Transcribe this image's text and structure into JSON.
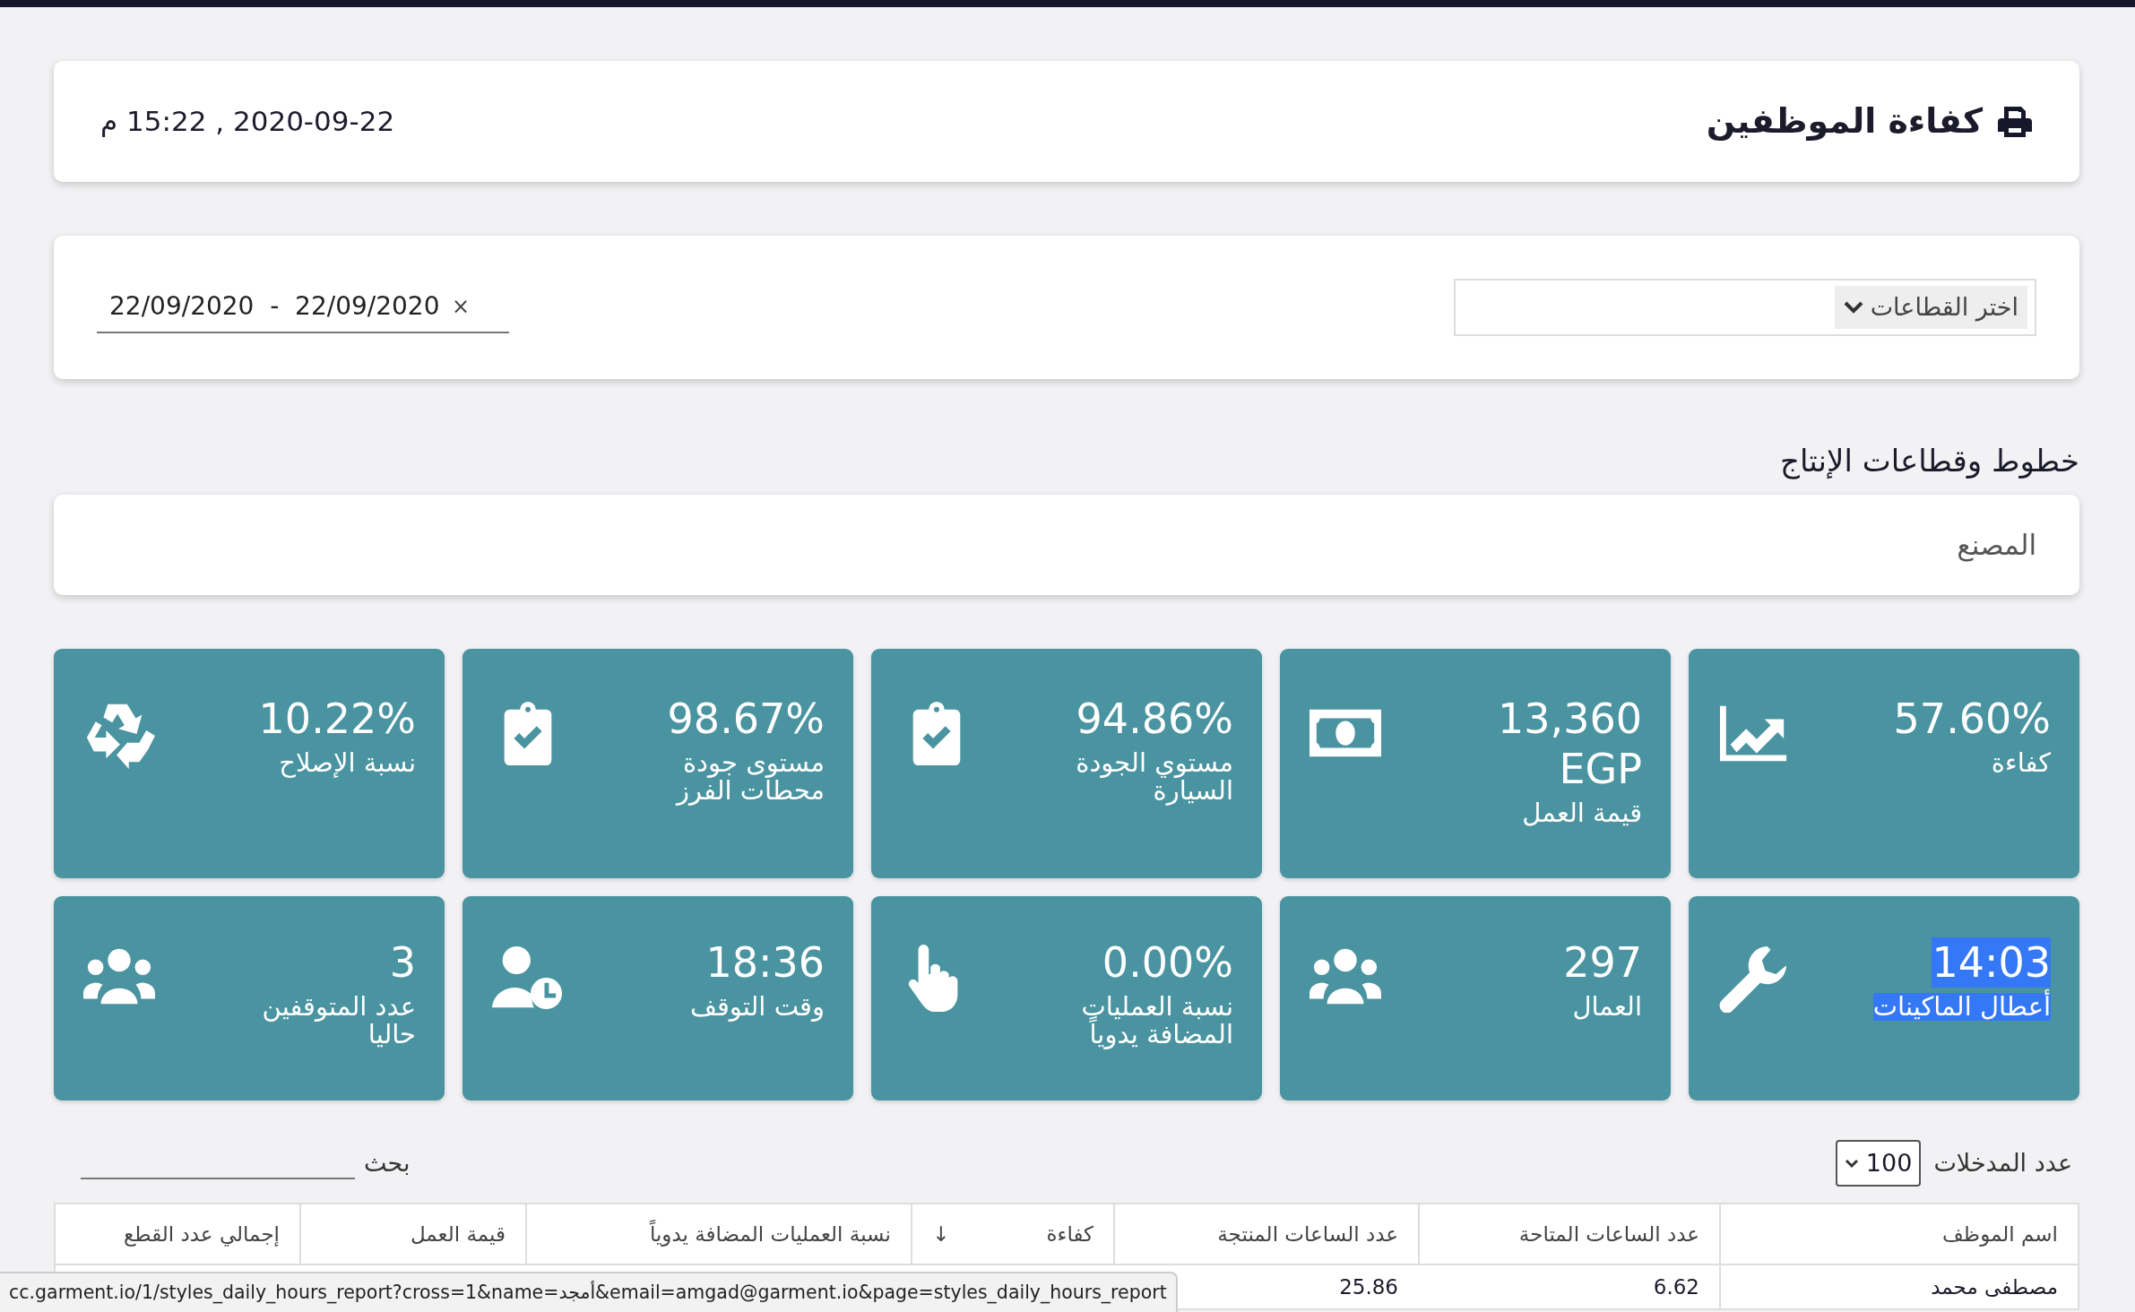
{
  "header": {
    "title": "كفاءة الموظفين",
    "datetime": "2020-09-22 , 15:22 م"
  },
  "filters": {
    "sectors_select": "اختر القطاعات",
    "date_range": "22/09/2020  -  22/09/2020",
    "clear": "×"
  },
  "section_title": "خطوط وقطاعات الإنتاج",
  "factory": "المصنع",
  "tiles": [
    {
      "value": "57.60%",
      "label": "كفاءة",
      "text_selected": false
    },
    {
      "value": "13,360 EGP",
      "label": "قيمة العمل",
      "text_selected": false
    },
    {
      "value": "94.86%",
      "label": "مستوي الجودة السيارة",
      "text_selected": false
    },
    {
      "value": "98.67%",
      "label": "مستوى جودة محطات الفرز",
      "text_selected": false
    },
    {
      "value": "10.22%",
      "label": "نسبة الإصلاح",
      "text_selected": false
    },
    {
      "value": "14:03",
      "label": "أعطال الماكينات",
      "text_selected": true
    },
    {
      "value": "297",
      "label": "العمال",
      "text_selected": false
    },
    {
      "value": "0.00%",
      "label": "نسبة العمليات المضافة يدوياً",
      "text_selected": false
    },
    {
      "value": "18:36",
      "label": "وقت التوقف",
      "text_selected": false
    },
    {
      "value": "3",
      "label": "عدد المتوقفين حاليا",
      "text_selected": false
    }
  ],
  "table_controls": {
    "entries_label": "عدد المدخلات",
    "entries_value": "100",
    "search_label": "بحث"
  },
  "table": {
    "columns": [
      {
        "label": "اسم الموظف"
      },
      {
        "label": "عدد الساعات المتاحة"
      },
      {
        "label": "عدد الساعات المنتجة"
      },
      {
        "label": "كفاءة",
        "sort_arrow": "↓"
      },
      {
        "label": "نسبة العمليات المضافة يدوياً"
      },
      {
        "label": "قيمة العمل"
      },
      {
        "label": "إجمالي عدد القطع"
      }
    ],
    "rows": [
      [
        "مصطفى محمد",
        "6.62",
        "25.86"
      ]
    ]
  },
  "status_bar": "cc.garment.io/1/styles_daily_hours_report?cross=1&name=أمجد&email=amgad@garment.io&page=styles_daily_hours_report"
}
